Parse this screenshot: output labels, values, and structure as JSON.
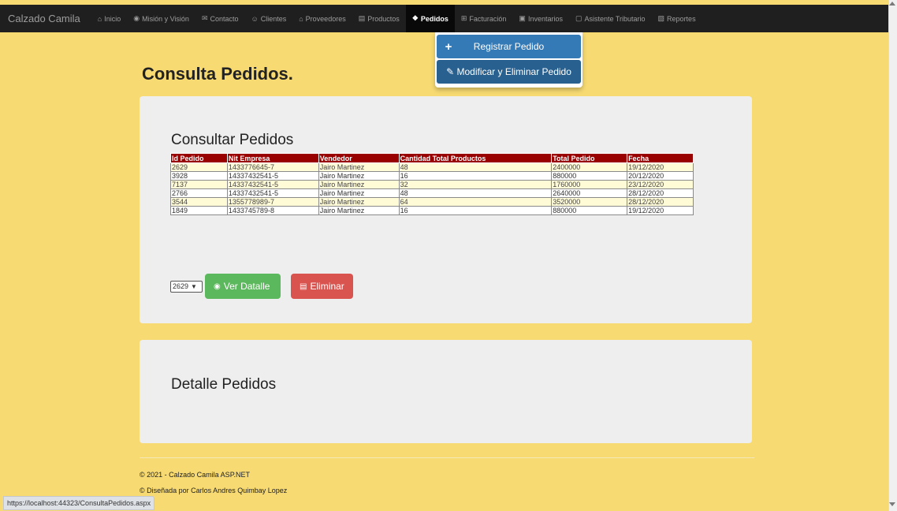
{
  "navbar": {
    "brand": "Calzado Camila",
    "items": [
      {
        "icon": "home-icon",
        "glyph": "⌂",
        "label": "Inicio",
        "active": false
      },
      {
        "icon": "eye-icon",
        "glyph": "◉",
        "label": "Misión y Visión",
        "active": false
      },
      {
        "icon": "envelope-icon",
        "glyph": "✉",
        "label": "Contacto",
        "active": false
      },
      {
        "icon": "users-icon",
        "glyph": "☺",
        "label": "Clientes",
        "active": false
      },
      {
        "icon": "bank-icon",
        "glyph": "⌂",
        "label": "Proveedores",
        "active": false
      },
      {
        "icon": "book-icon",
        "glyph": "▤",
        "label": "Productos",
        "active": false
      },
      {
        "icon": "cubes-icon",
        "glyph": "❖",
        "label": "Pedidos",
        "active": true
      },
      {
        "icon": "cart-icon",
        "glyph": "⊞",
        "label": "Facturación",
        "active": false
      },
      {
        "icon": "inbox-icon",
        "glyph": "▣",
        "label": "Inventarios",
        "active": false
      },
      {
        "icon": "calendar-icon",
        "glyph": "▢",
        "label": "Asistente Tributario",
        "active": false
      },
      {
        "icon": "file-icon",
        "glyph": "▧",
        "label": "Reportes",
        "active": false
      }
    ]
  },
  "dropdown": {
    "register_label": "Registrar Pedido",
    "modify_label": "Modificar y Eliminar Pedido"
  },
  "page": {
    "title": "Consulta Pedidos."
  },
  "consult_panel": {
    "heading": "Consultar Pedidos",
    "columns": [
      "Id Pedido",
      "Nit Empresa",
      "Vendedor",
      "Cantidad Total Productos",
      "Total Pedido",
      "Fecha"
    ],
    "rows": [
      [
        "2629",
        "1433776645-7",
        "Jairo Martinez",
        "48",
        "2400000",
        "19/12/2020"
      ],
      [
        "3928",
        "14337432541-5",
        "Jairo Martinez",
        "16",
        "880000",
        "20/12/2020"
      ],
      [
        "7137",
        "14337432541-5",
        "Jairo Martinez",
        "32",
        "1760000",
        "23/12/2020"
      ],
      [
        "2766",
        "14337432541-5",
        "Jairo Martinez",
        "48",
        "2640000",
        "28/12/2020"
      ],
      [
        "3544",
        "1355778989-7",
        "Jairo Martinez",
        "64",
        "3520000",
        "28/12/2020"
      ],
      [
        "1849",
        "1433745789-8",
        "Jairo Martinez",
        "16",
        "880000",
        "19/12/2020"
      ]
    ],
    "select_value": "2629",
    "view_button": "Ver Datalle",
    "delete_button": "Eliminar"
  },
  "detail_panel": {
    "heading": "Detalle Pedidos"
  },
  "footer": {
    "copyright": "© 2021 - Calzado Camila ASP.NET",
    "designed_by": "© Diseñada por Carlos Andres Quimbay Lopez"
  },
  "statusbar": {
    "url": "https://localhost:44323/ConsultaPedidos.aspx"
  }
}
